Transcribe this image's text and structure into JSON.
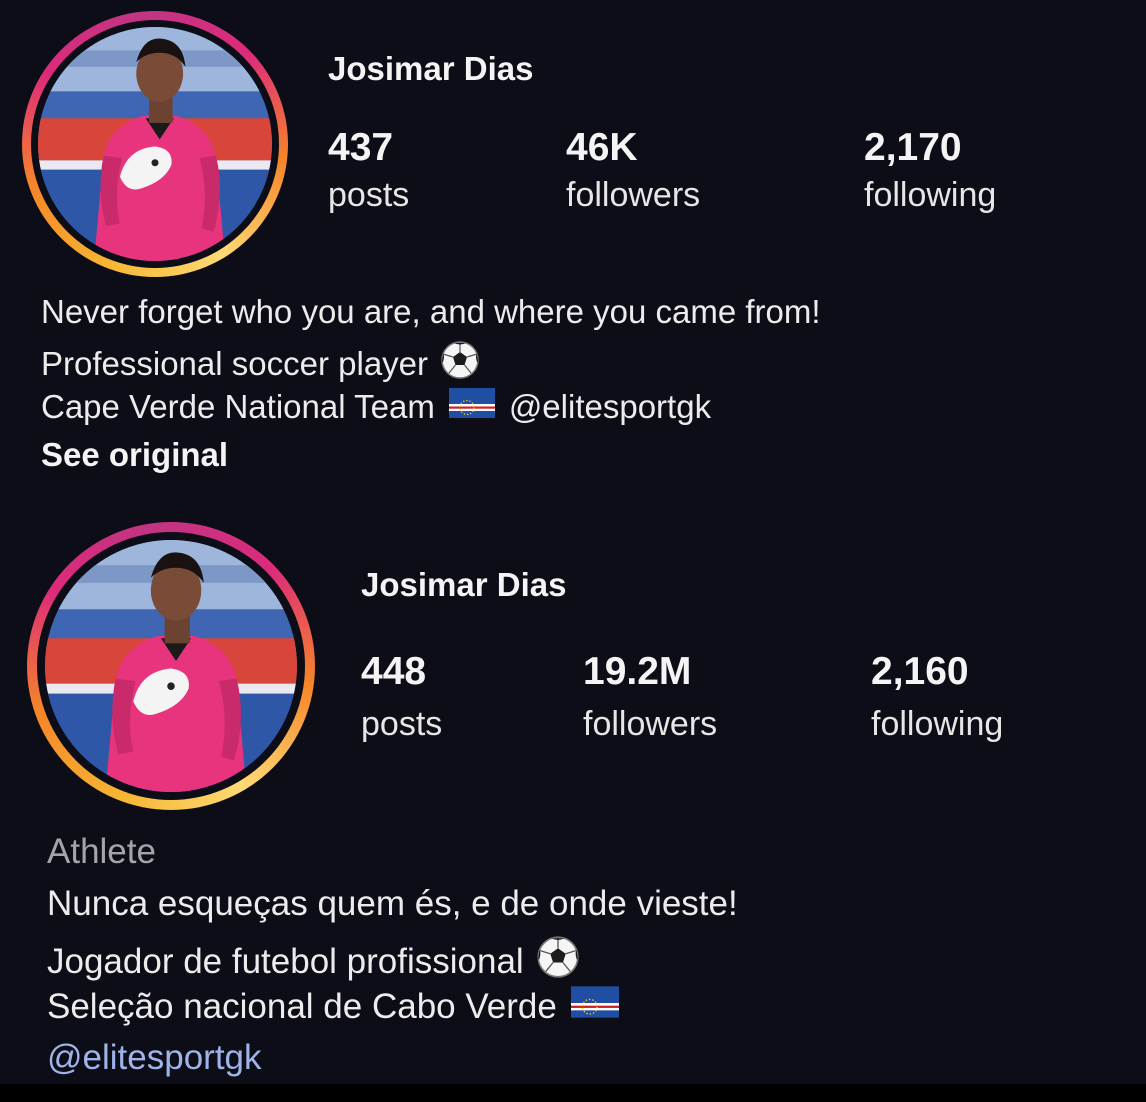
{
  "profile_1": {
    "name": "Josimar Dias",
    "stats": [
      {
        "value": "437",
        "label": "posts"
      },
      {
        "value": "46K",
        "label": "followers"
      },
      {
        "value": "2,170",
        "label": "following"
      }
    ],
    "bio": [
      "Never forget who you are, and where you came from!",
      "Professional soccer player",
      "Cape Verde National Team",
      "@elitesportgk"
    ],
    "see_original": "See original",
    "icons": [
      "soccer-ball-icon",
      "cape-verde-flag-icon"
    ]
  },
  "profile_2": {
    "name": "Josimar Dias",
    "stats": [
      {
        "value": "448",
        "label": "posts"
      },
      {
        "value": "19.2M",
        "label": "followers"
      },
      {
        "value": "2,160",
        "label": "following"
      }
    ],
    "category": "Athlete",
    "bio": [
      "Nunca esqueças quem és, e de onde vieste!",
      "Jogador de futebol profissional",
      "Seleção nacional de Cabo Verde"
    ],
    "link": "@elitesportgk",
    "icons": [
      "soccer-ball-icon",
      "cape-verde-flag-icon"
    ]
  },
  "colors": {
    "background": "#0d0d18",
    "link": "#9fb3e8",
    "category": "#a4a4aa",
    "story_ring": [
      "#feda75",
      "#f58529",
      "#dd2a7b",
      "#c13584"
    ],
    "jersey": "#e8337d"
  }
}
